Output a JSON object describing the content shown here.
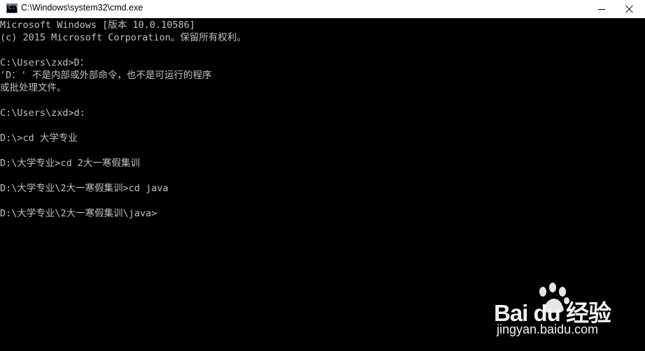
{
  "window": {
    "title": "C:\\Windows\\system32\\cmd.exe",
    "icon": "cmd-console-icon",
    "controls": {
      "minimize_icon": "minimize-icon",
      "close_icon": "close-icon"
    }
  },
  "console": {
    "background": "#000000",
    "foreground": "#c0c0c0",
    "lines": [
      "Microsoft Windows [版本 10.0.10586]",
      "(c) 2015 Microsoft Corporation。保留所有权利。",
      "",
      "C:\\Users\\zxd>D：",
      "'D：' 不是内部或外部命令，也不是可运行的程序",
      "或批处理文件。",
      "",
      "C:\\Users\\zxd>d:",
      "",
      "D:\\>cd 大学专业",
      "",
      "D:\\大学专业>cd 2大一寒假集训",
      "",
      "D:\\大学专业\\2大一寒假集训>cd java",
      "",
      "D:\\大学专业\\2大一寒假集训\\java>"
    ]
  },
  "watermark": {
    "brand": "Bai du 经验",
    "domain": "jingyan.baidu.com",
    "icon": "baidu-paw-icon"
  }
}
